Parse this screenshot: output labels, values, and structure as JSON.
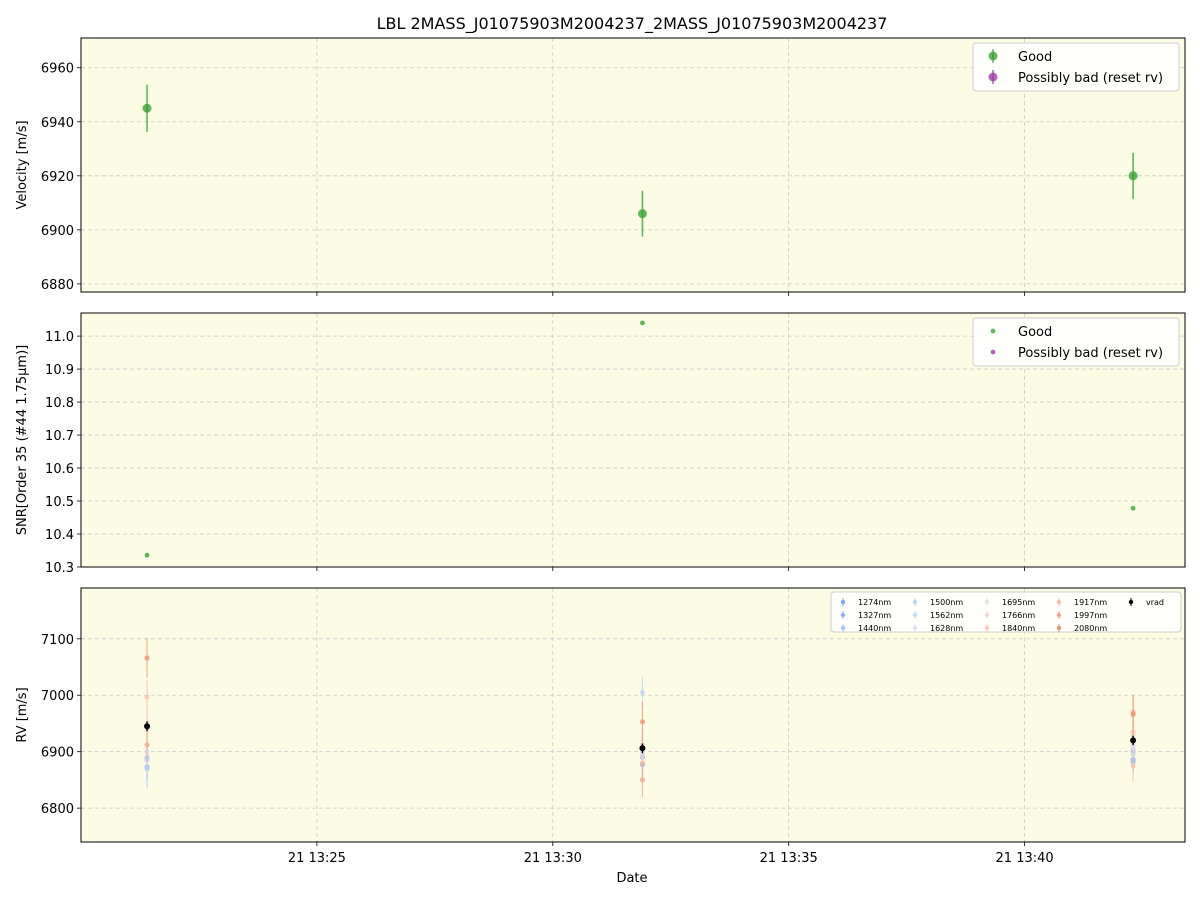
{
  "title": "LBL 2MASS_J01075903M2004237_2MASS_J01075903M2004237",
  "xlabel": "Date",
  "x_ticks": [
    "21 13:25",
    "21 13:30",
    "21 13:35",
    "21 13:40"
  ],
  "x_tick_minutes": [
    25,
    30,
    35,
    40
  ],
  "xlim_minutes": [
    20.0,
    43.4
  ],
  "colors": {
    "background": "#fcfce4",
    "good": "#2ca02c",
    "bad": "#9b30a0",
    "grid": "#c8c8c8",
    "vrad": "#000000"
  },
  "chart_data": [
    {
      "type": "scatter",
      "name": "velocity",
      "ylabel": "Velocity [m/s]",
      "ylim": [
        6877,
        6971
      ],
      "y_ticks": [
        "6880",
        "6900",
        "6920",
        "6940",
        "6960"
      ],
      "grid": true,
      "legend_position": "top-right",
      "legend": [
        "Good",
        "Possibly bad (reset rv)"
      ],
      "series": [
        {
          "name": "Good",
          "x_minutes": [
            21.4,
            31.9,
            42.3
          ],
          "x_labels": [
            "13:21:24",
            "13:31:54",
            "13:42:18"
          ],
          "y": [
            6945,
            6906,
            6920
          ],
          "yerr": [
            8.7,
            8.5,
            8.5
          ]
        },
        {
          "name": "Possibly bad (reset rv)",
          "x_minutes": [],
          "y": [],
          "yerr": []
        }
      ]
    },
    {
      "type": "scatter",
      "name": "snr",
      "ylabel": "SNR[Order 35 (#44 1.75μm)]",
      "ylim": [
        10.3,
        11.07
      ],
      "y_ticks": [
        "10.3",
        "10.4",
        "10.5",
        "10.6",
        "10.7",
        "10.8",
        "10.9",
        "11.0"
      ],
      "grid": true,
      "legend_position": "top-right",
      "legend": [
        "Good",
        "Possibly bad (reset rv)"
      ],
      "series": [
        {
          "name": "Good",
          "x_minutes": [
            21.4,
            31.9,
            42.3
          ],
          "y": [
            10.336,
            11.04,
            10.478
          ]
        },
        {
          "name": "Possibly bad (reset rv)",
          "x_minutes": [],
          "y": []
        }
      ]
    },
    {
      "type": "scatter",
      "name": "rv",
      "ylabel": "RV [m/s]",
      "ylim": [
        6740,
        7190
      ],
      "y_ticks": [
        "6800",
        "6900",
        "7000",
        "7100"
      ],
      "grid": true,
      "legend_position": "top-right",
      "legend_columns": 5,
      "series": [
        {
          "name": "1274nm",
          "color": "#7ba6f0",
          "y": [
            6888,
            6878,
            6886
          ],
          "yerr": [
            20,
            20,
            20
          ]
        },
        {
          "name": "1327nm",
          "color": "#8fb4f2",
          "y": [
            6873,
            6878,
            6882
          ],
          "yerr": [
            20,
            20,
            20
          ]
        },
        {
          "name": "1440nm",
          "color": "#a9c6f4",
          "y": [
            6870,
            6890,
            6900
          ],
          "yerr": [
            35,
            35,
            35
          ]
        },
        {
          "name": "1500nm",
          "color": "#bcd2f4",
          "y": [
            6890,
            7005,
            6905
          ],
          "yerr": [
            28,
            28,
            28
          ]
        },
        {
          "name": "1562nm",
          "color": "#c8daf6",
          "y": [
            6885,
            6895,
            6895
          ],
          "yerr": [
            25,
            25,
            25
          ]
        },
        {
          "name": "1628nm",
          "color": "#d8e2f2",
          "y": [
            6900,
            6900,
            6910
          ],
          "yerr": [
            25,
            25,
            25
          ]
        },
        {
          "name": "1695nm",
          "color": "#e4e4e4",
          "y": [
            6940,
            6905,
            6915
          ],
          "yerr": [
            25,
            25,
            25
          ]
        },
        {
          "name": "1766nm",
          "color": "#f2d8cc",
          "y": [
            6950,
            6910,
            6930
          ],
          "yerr": [
            30,
            30,
            30
          ]
        },
        {
          "name": "1840nm",
          "color": "#f4ccc0",
          "y": [
            6945,
            6912,
            6935
          ],
          "yerr": [
            30,
            30,
            30
          ]
        },
        {
          "name": "1917nm",
          "color": "#f6c0a8",
          "y": [
            6997,
            6880,
            6875
          ],
          "yerr": [
            30,
            30,
            30
          ]
        },
        {
          "name": "1997nm",
          "color": "#f2a488",
          "y": [
            6912,
            6850,
            6970
          ],
          "yerr": [
            30,
            30,
            30
          ]
        },
        {
          "name": "2080nm",
          "color": "#ee9070",
          "y": [
            7066,
            6953,
            6966
          ],
          "yerr": [
            35,
            35,
            35
          ]
        },
        {
          "name": "vrad",
          "color": "#000000",
          "y": [
            6945,
            6906,
            6920
          ],
          "yerr": [
            8.7,
            8.5,
            8.5
          ]
        }
      ],
      "x_minutes": [
        21.4,
        31.9,
        42.3
      ]
    }
  ]
}
